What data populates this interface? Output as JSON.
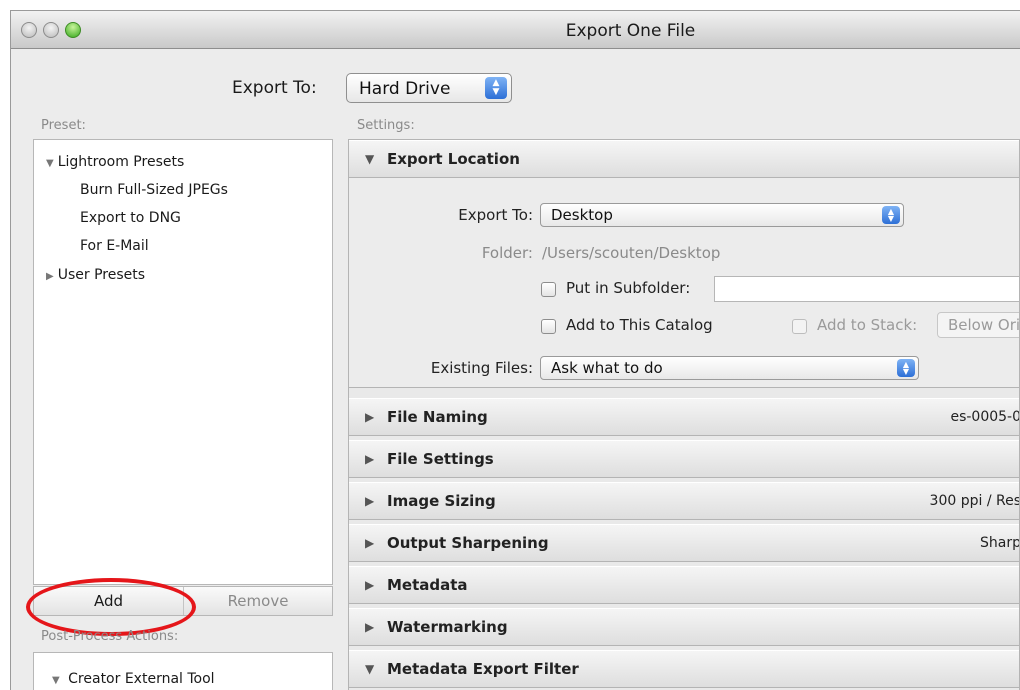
{
  "window": {
    "title": "Export One File"
  },
  "export_to": {
    "label": "Export To:",
    "value": "Hard Drive"
  },
  "preset": {
    "label": "Preset:",
    "items": [
      {
        "label": "Lightroom Presets",
        "expanded": true
      },
      {
        "label": "Burn Full-Sized JPEGs"
      },
      {
        "label": "Export to DNG"
      },
      {
        "label": "For E-Mail"
      },
      {
        "label": "User Presets",
        "expanded": false
      }
    ],
    "add_label": "Add",
    "remove_label": "Remove"
  },
  "post_process": {
    "label": "Post-Process Actions:",
    "items": [
      {
        "label": "Creator External Tool",
        "expanded": true
      }
    ]
  },
  "settings": {
    "label": "Settings:",
    "export_location": {
      "title": "Export Location",
      "export_to_label": "Export To:",
      "export_to_value": "Desktop",
      "folder_label": "Folder:",
      "folder_value": "/Users/scouten/Desktop",
      "put_in_subfolder_label": "Put in Subfolder:",
      "add_to_catalog_label": "Add to This Catalog",
      "add_to_stack_label": "Add to Stack:",
      "stack_value": "Below Ori",
      "existing_files_label": "Existing Files:",
      "existing_files_value": "Ask what to do"
    },
    "sections": [
      {
        "title": "File Naming",
        "summary": "es-0005-0"
      },
      {
        "title": "File Settings",
        "summary": ""
      },
      {
        "title": "Image Sizing",
        "summary": "300 ppi / Res"
      },
      {
        "title": "Output Sharpening",
        "summary": "Sharp"
      },
      {
        "title": "Metadata",
        "summary": ""
      },
      {
        "title": "Watermarking",
        "summary": ""
      },
      {
        "title": "Metadata Export Filter",
        "summary": ""
      }
    ]
  },
  "annotation": {
    "highlight_color": "#e5161a"
  }
}
